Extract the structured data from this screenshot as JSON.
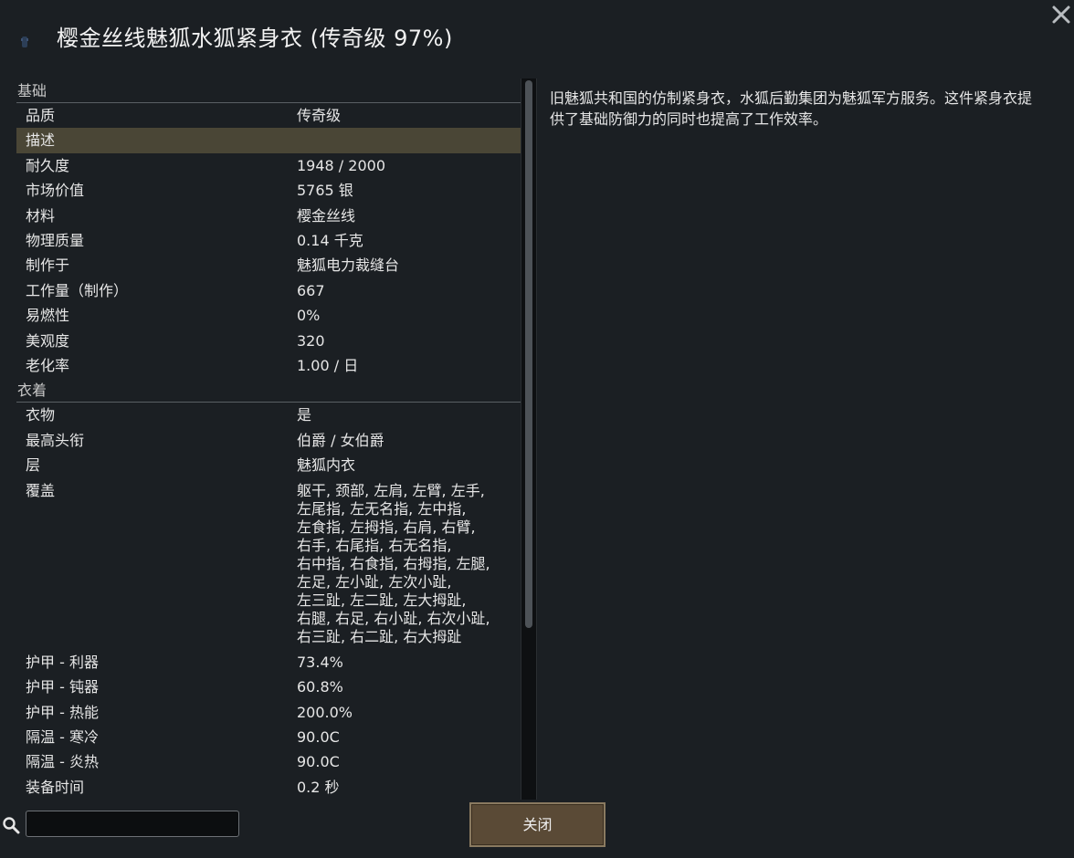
{
  "window": {
    "title": "樱金丝线魅狐水狐紧身衣 (传奇级 97%)",
    "close_icon": "close-icon",
    "item_icon": "apparel-icon"
  },
  "sections": [
    {
      "header": "基础",
      "rows": [
        {
          "label": "品质",
          "value": "传奇级"
        },
        {
          "label": "描述",
          "value": "",
          "highlight": true
        },
        {
          "label": "耐久度",
          "value": "1948 / 2000"
        },
        {
          "label": "市场价值",
          "value": "5765 银"
        },
        {
          "label": "材料",
          "value": "樱金丝线"
        },
        {
          "label": "物理质量",
          "value": "0.14 千克"
        },
        {
          "label": "制作于",
          "value": "魅狐电力裁缝台"
        },
        {
          "label": "工作量（制作）",
          "value": "667"
        },
        {
          "label": "易燃性",
          "value": "0%"
        },
        {
          "label": "美观度",
          "value": "320"
        },
        {
          "label": "老化率",
          "value": "1.00 / 日"
        }
      ]
    },
    {
      "header": "衣着",
      "rows": [
        {
          "label": "衣物",
          "value": "是"
        },
        {
          "label": "最高头衔",
          "value": "伯爵 / 女伯爵"
        },
        {
          "label": "层",
          "value": "魅狐内衣"
        },
        {
          "label": "覆盖",
          "value": "躯干, 颈部, 左肩, 左臂, 左手,\n左尾指, 左无名指, 左中指,\n左食指, 左拇指, 右肩, 右臂,\n右手, 右尾指, 右无名指,\n右中指, 右食指, 右拇指, 左腿,\n左足, 左小趾, 左次小趾,\n左三趾, 左二趾, 左大拇趾,\n右腿, 右足, 右小趾, 右次小趾,\n右三趾, 右二趾, 右大拇趾",
          "multi": true
        },
        {
          "label": "护甲 - 利器",
          "value": "73.4%"
        },
        {
          "label": "护甲 - 钝器",
          "value": "60.8%"
        },
        {
          "label": "护甲 - 热能",
          "value": "200.0%"
        },
        {
          "label": "隔温 - 寒冷",
          "value": "90.0C"
        },
        {
          "label": "隔温 - 炎热",
          "value": "90.0C"
        },
        {
          "label": "装备时间",
          "value": "0.2 秒"
        }
      ]
    }
  ],
  "description": "旧魅狐共和国的仿制紧身衣，水狐后勤集团为魅狐军方服务。这件紧身衣提供了基础防御力的同时也提高了工作效率。",
  "search": {
    "icon": "search-icon",
    "value": "",
    "placeholder": ""
  },
  "footer": {
    "close_label": "关闭"
  },
  "colors": {
    "background": "#1b1f23",
    "highlight_row": "#4a4636",
    "button": "#5a4a36",
    "button_border": "#8a7a60"
  }
}
